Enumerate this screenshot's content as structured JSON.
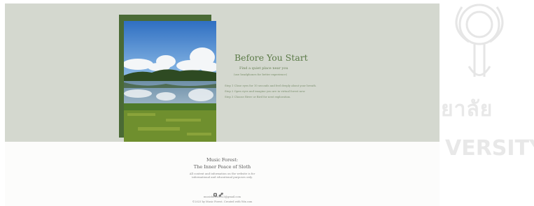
{
  "hero": {
    "title": "Before You Start",
    "subtitle": "Find a quiet place near you",
    "subnote": "(use headphones for better experience)",
    "steps": [
      "Step 1 Close eyes for 10 seconds and feel deeply about your breath.",
      "Step 2 Open eyes and imagine you are in virtual forest now.",
      "Step 3 Choose River or Bird for next exploration."
    ]
  },
  "footer": {
    "brand": "Music Forest:",
    "tagline": "The Inner Peace of Sloth",
    "note_line1": "All content and information on the website is for",
    "note_line2": "informational and educational purposes only.",
    "icons": [
      "instagram-icon",
      "link-icon"
    ],
    "email": "musicforest2023@gmail.com",
    "copyright": "©2023 by Music Forest. Created with Wix.com"
  },
  "colors": {
    "hero_bg": "#d4d8cf",
    "frame_green": "#4a6a35",
    "title_green": "#5b7a47",
    "footer_bg": "#fcfcfb"
  }
}
